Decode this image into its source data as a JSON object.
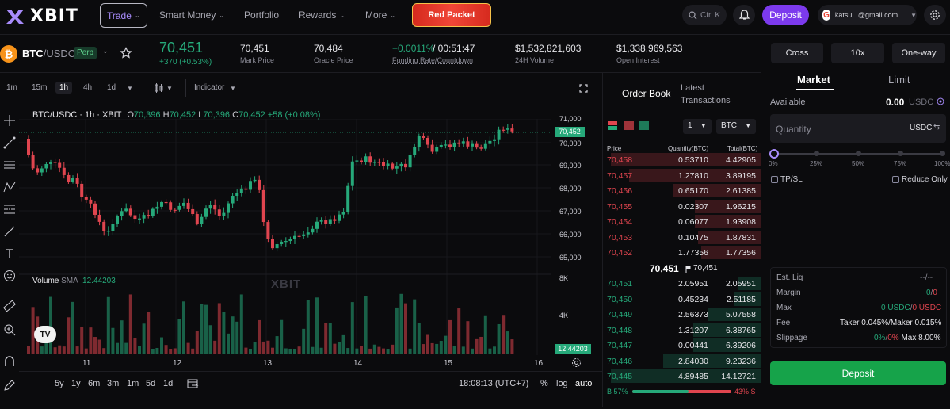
{
  "nav": {
    "logo": "XBIT",
    "trade": "Trade",
    "smart_money": "Smart Money",
    "portfolio": "Portfolio",
    "rewards": "Rewards",
    "more": "More",
    "red_packet": "Red Packet",
    "search_hint": "Ctrl K",
    "deposit": "Deposit",
    "account_email": "katsu...@gmail.com"
  },
  "ticker": {
    "pair_base": "BTC",
    "pair_quote": "/USDC",
    "badge": "Perp",
    "last_price": "70,451",
    "change": "+370 (+0.53%)",
    "mark_price": "70,451",
    "mark_price_label": "Mark Price",
    "oracle_price": "70,484",
    "oracle_price_label": "Oracle Price",
    "funding_rate": "+0.0011%",
    "countdown": "/ 00:51:47",
    "funding_label": "Funding Rate/Countdown",
    "volume": "$1,532,821,603",
    "volume_label": "24H Volume",
    "open_interest": "$1,338,969,563",
    "open_interest_label": "Open Interest"
  },
  "chart_toolbar": {
    "timeframes": [
      "1m",
      "15m",
      "1h",
      "4h",
      "1d"
    ],
    "active": "1h",
    "indicator": "Indicator"
  },
  "chart": {
    "legend_title": "BTC/USDC · 1h · XBIT",
    "o_label": "O",
    "o": "70,396",
    "h_label": "H",
    "h": "70,452",
    "l_label": "L",
    "l": "70,396",
    "c_label": "C",
    "c": "70,452",
    "chg": "+58 (+0.08%)",
    "volume_label": "Volume",
    "sma_label": "SMA",
    "sma_value": "12.44203",
    "price_ticks": [
      "71,000",
      "70,000",
      "69,000",
      "68,000",
      "67,000",
      "66,000",
      "65,000"
    ],
    "current_price_tag": "70,452",
    "volume_ticks": [
      "8K",
      "4K"
    ],
    "volume_tag": "12.44203",
    "date_ticks": [
      "11",
      "12",
      "13",
      "14",
      "15",
      "16"
    ],
    "ranges": [
      "5y",
      "1y",
      "6m",
      "3m",
      "1m",
      "5d",
      "1d"
    ],
    "clock": "18:08:13 (UTC+7)",
    "pct": "%",
    "log": "log",
    "auto": "auto",
    "watermark": "XBIT",
    "tv_logo": "TV"
  },
  "orderbook": {
    "tab_orderbook": "Order Book",
    "tab_latest_1": "Latest",
    "tab_latest_2": "Transactions",
    "step": "1",
    "unit": "BTC",
    "col_price": "Price",
    "col_qty": "Quantity(BTC)",
    "col_total": "Total(BTC)",
    "asks": [
      {
        "price": "70,458",
        "qty": "0.53710",
        "total": "4.42905",
        "depth": 1.0
      },
      {
        "price": "70,457",
        "qty": "1.27810",
        "total": "3.89195",
        "depth": 0.88
      },
      {
        "price": "70,456",
        "qty": "0.65170",
        "total": "2.61385",
        "depth": 0.59
      },
      {
        "price": "70,455",
        "qty": "0.02307",
        "total": "1.96215",
        "depth": 0.44
      },
      {
        "price": "70,454",
        "qty": "0.06077",
        "total": "1.93908",
        "depth": 0.44
      },
      {
        "price": "70,453",
        "qty": "0.10475",
        "total": "1.87831",
        "depth": 0.42
      },
      {
        "price": "70,452",
        "qty": "1.77356",
        "total": "1.77356",
        "depth": 0.4
      }
    ],
    "mid_price": "70,451",
    "mid_mark": "70,451",
    "bids": [
      {
        "price": "70,451",
        "qty": "2.05951",
        "total": "2.05951",
        "depth": 0.15
      },
      {
        "price": "70,450",
        "qty": "0.45234",
        "total": "2.51185",
        "depth": 0.18
      },
      {
        "price": "70,449",
        "qty": "2.56373",
        "total": "5.07558",
        "depth": 0.36
      },
      {
        "price": "70,448",
        "qty": "1.31207",
        "total": "6.38765",
        "depth": 0.45
      },
      {
        "price": "70,447",
        "qty": "0.00441",
        "total": "6.39206",
        "depth": 0.45
      },
      {
        "price": "70,446",
        "qty": "2.84030",
        "total": "9.23236",
        "depth": 0.65
      },
      {
        "price": "70,445",
        "qty": "4.89485",
        "total": "14.12721",
        "depth": 1.0
      }
    ],
    "buy_label": "B 57%",
    "sell_label": "43% S",
    "buy_ratio": 0.57
  },
  "order_panel": {
    "cross": "Cross",
    "leverage": "10x",
    "mode": "One-way",
    "tab_market": "Market",
    "tab_limit": "Limit",
    "available_label": "Available",
    "available_value": "0.00",
    "available_unit": "USDC",
    "quantity_placeholder": "Quantity",
    "quantity_unit": "USDC",
    "slider_marks": [
      "0%",
      "25%",
      "50%",
      "75%",
      "100%"
    ],
    "slider_level": 0.0,
    "tpsl": "TP/SL",
    "reduce_only": "Reduce Only",
    "est_liq_label": "Est. Liq",
    "est_liq": "--/--",
    "margin_label": "Margin",
    "margin_a": "0",
    "margin_b": "0",
    "max_label": "Max",
    "max_a": "0 USDC",
    "max_b": "0 USDC",
    "fee_label": "Fee",
    "fee": "Taker 0.045%/Maker 0.015%",
    "slippage_label": "Slippage",
    "slippage_a": "0%",
    "slippage_b": "0%",
    "slippage_max": "Max 8.00%",
    "deposit": "Deposit"
  },
  "colors": {
    "up": "#26a97a",
    "down": "#e0454f",
    "accent": "#7c3aed",
    "deposit_green": "#16a34a"
  }
}
